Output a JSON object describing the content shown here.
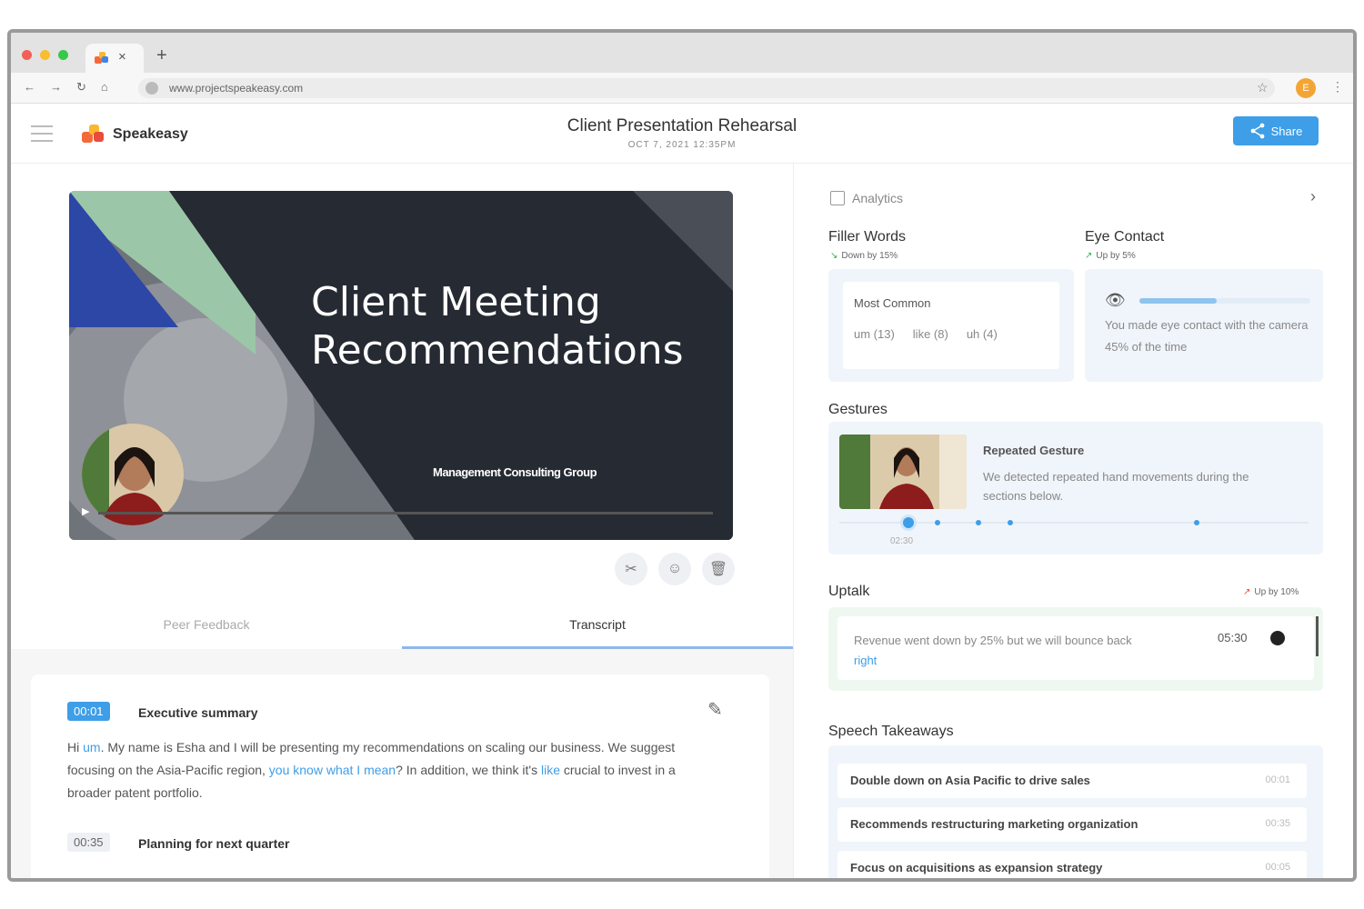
{
  "browser": {
    "tab_close": "×",
    "new_tab": "+",
    "url": "www.projectspeakeasy.com",
    "profile_initial": "E",
    "colors": {
      "close": "#f25f58",
      "minimize": "#f9bd2e",
      "maximize": "#36c84b"
    }
  },
  "header": {
    "brand": "Speakeasy",
    "title": "Client Presentation Rehearsal",
    "date": "OCT 7, 2021 12:35PM",
    "share_label": "Share"
  },
  "video": {
    "slide_title_line1": "Client Meeting",
    "slide_title_line2": "Recommendations",
    "slide_subtitle": "Management Consulting Group",
    "progress_fraction": 0.02
  },
  "tabs": {
    "peer_feedback": "Peer Feedback",
    "transcript": "Transcript",
    "active": "transcript"
  },
  "transcript": {
    "sections": [
      {
        "time": "00:01",
        "title": "Executive summary",
        "text_parts": [
          {
            "t": "Hi ",
            "hl": false
          },
          {
            "t": "um",
            "hl": true
          },
          {
            "t": ". My name is Esha and I will be presenting my recommendations on scaling our business. We suggest focusing on the Asia-Pacific region, ",
            "hl": false
          },
          {
            "t": "you know what I mean",
            "hl": true
          },
          {
            "t": "? In addition, we think it's ",
            "hl": false
          },
          {
            "t": "like",
            "hl": true
          },
          {
            "t": " crucial to invest in a broader patent portfolio.",
            "hl": false
          }
        ]
      },
      {
        "time": "00:35",
        "title": "Planning for next quarter"
      }
    ]
  },
  "analytics": {
    "label": "Analytics",
    "filler_words": {
      "heading": "Filler Words",
      "trend": "Down by 15%",
      "box_title": "Most Common",
      "words": [
        "um (13)",
        "like (8)",
        "uh (4)"
      ]
    },
    "eye_contact": {
      "heading": "Eye Contact",
      "trend": "Up by 5%",
      "percent": 45,
      "text": "You made eye contact with the camera 45% of the time"
    },
    "gestures": {
      "heading": "Gestures",
      "title": "Repeated Gesture",
      "text": "We detected repeated hand movements during the sections below.",
      "time_label": "02:30"
    },
    "uptalk": {
      "heading": "Uptalk",
      "trend": "Up by 10%",
      "text_plain": "Revenue went down by 25% but we will bounce back ",
      "text_highlight": "right",
      "time": "05:30"
    },
    "takeaways": {
      "heading": "Speech Takeaways",
      "items": [
        {
          "label": "Double down on Asia Pacific to drive sales",
          "time": "00:01"
        },
        {
          "label": "Recommends restructuring marketing organization",
          "time": "00:35"
        },
        {
          "label": "Focus on acquisitions as expansion strategy",
          "time": "00:05"
        }
      ]
    }
  }
}
